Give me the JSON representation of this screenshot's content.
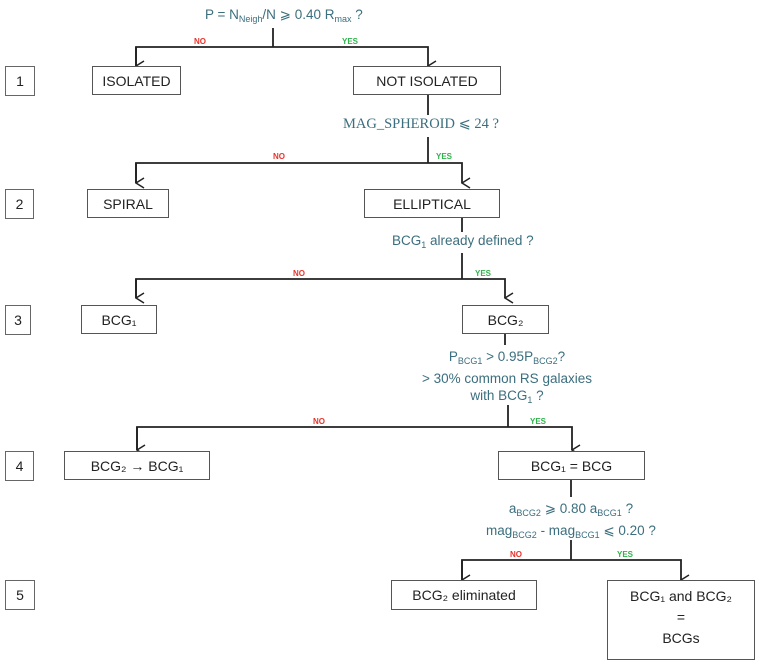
{
  "labels": {
    "no": "NO",
    "yes": "YES"
  },
  "steps": [
    "1",
    "2",
    "3",
    "4",
    "5"
  ],
  "questions": {
    "q1": {
      "p": "P = N",
      "sub1": "Neigh",
      "mid": "/N ⩾ 0.40 R",
      "sub2": "max",
      "end": " ?"
    },
    "q2": {
      "text": "MAG_SPHEROID ⩽ 24 ?"
    },
    "q3": {
      "pre": "BCG",
      "sub": "1",
      "post": " already defined ?"
    },
    "q4": {
      "line1_a": "P",
      "line1_sub1": "BCG1",
      "line1_b": " > 0.95P",
      "line1_sub2": "BCG2",
      "line1_c": "?",
      "line2": "> 30% common RS galaxies",
      "line3_a": "with BCG",
      "line3_sub": "1",
      "line3_b": " ?"
    },
    "q5": {
      "line1_a": "a",
      "line1_sub1": "BCG2",
      "line1_b": " ⩾ 0.80 a",
      "line1_sub2": "BCG1",
      "line1_c": " ?",
      "line2_a": "mag",
      "line2_sub1": "BCG2",
      "line2_b": " - mag",
      "line2_sub2": "BCG1",
      "line2_c": " ⩽ 0.20 ?"
    }
  },
  "nodes": {
    "isolated": "ISOLATED",
    "not_isolated": "NOT ISOLATED",
    "spiral": "SPIRAL",
    "elliptical": "ELLIPTICAL",
    "bcg1": "BCG₁",
    "bcg2": "BCG₂",
    "bcg2_to_bcg1": "BCG₂ → BCG₁",
    "bcg1_eq_bcg": "BCG₁ = BCG",
    "bcg2_eliminated": "BCG₂ eliminated",
    "both_line1": "BCG₁ and BCG₂",
    "both_line2": "=",
    "both_line3": "BCGs"
  }
}
